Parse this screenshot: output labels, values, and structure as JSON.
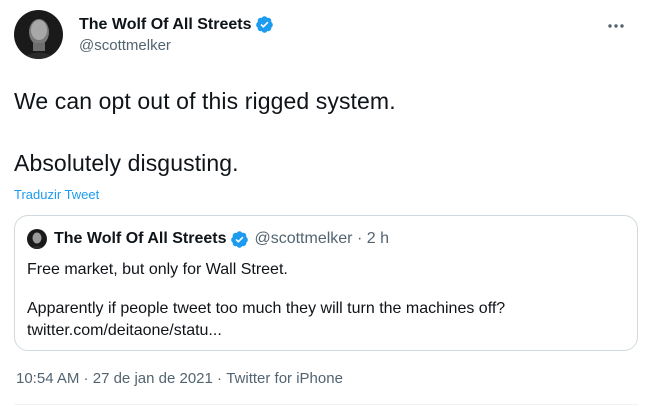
{
  "author": {
    "display_name": "The Wolf Of All Streets",
    "handle": "@scottmelker",
    "verified": true
  },
  "tweet": {
    "line1": "We can opt out of this rigged system.",
    "line2": "Absolutely disgusting.",
    "translate_label": "Traduzir Tweet"
  },
  "quoted_tweet": {
    "display_name": "The Wolf Of All Streets",
    "handle_time": "@scottmelker · 2 h",
    "line1": "Free market, but only for Wall Street.",
    "line2": "Apparently if people tweet too much they will turn the machines off?",
    "line3": "twitter.com/deitaone/statu..."
  },
  "meta": {
    "time": "10:54 AM",
    "sep1": " · ",
    "date": "27 de jan de 2021",
    "sep2": " · ",
    "source": "Twitter for iPhone"
  },
  "icons": {
    "verified": "verified-badge-icon",
    "more": "more-dots-icon"
  },
  "colors": {
    "accent": "#1d9bf0",
    "muted": "#536471",
    "text": "#0f1419",
    "border": "#cfd9de"
  }
}
